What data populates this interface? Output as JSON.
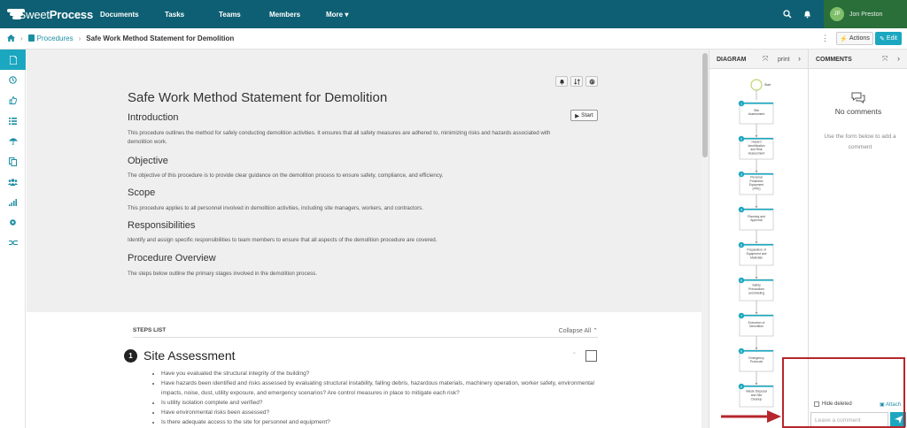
{
  "app": {
    "logo": {
      "sweet": "Sweet",
      "process": "Process"
    },
    "nav": [
      "Documents",
      "Tasks",
      "Teams",
      "Members",
      "More"
    ],
    "user": {
      "initials": "JP",
      "name": "Jon Preston"
    }
  },
  "breadcrumb": {
    "parent": "Procedures",
    "current": "Safe Work Method Statement for Demolition",
    "actions_label": "Actions",
    "edit_label": "Edit"
  },
  "document": {
    "title": "Safe Work Method Statement for Demolition",
    "start_label": "Start",
    "sections": [
      {
        "heading": "Introduction",
        "body": "This procedure outlines the method for safely conducting demolition activities. It ensures that all safety measures are adhered to, minimizing risks and hazards associated with demolition work."
      },
      {
        "heading": "Objective",
        "body": "The objective of this procedure is to provide clear guidance on the demolition process to ensure safety, compliance, and efficiency."
      },
      {
        "heading": "Scope",
        "body": "This procedure applies to all personnel involved in demolition activities, including site managers, workers, and contractors."
      },
      {
        "heading": "Responsibilities",
        "body": "Identify and assign specific responsibilities to team members to ensure that all aspects of the demolition procedure are covered."
      },
      {
        "heading": "Procedure Overview",
        "body": "The steps below outline the primary stages involved in the demolition process."
      }
    ]
  },
  "steps": {
    "label": "STEPS LIST",
    "collapse_label": "Collapse All",
    "step1": {
      "number": "1",
      "title": "Site Assessment",
      "items": [
        "Have you evaluated the structural integrity of the building?",
        "Have hazards been identified and risks assessed by evaluating structural instability, falling debris, hazardous materials, machinery operation, worker safety, environmental impacts, noise, dust, utility exposure, and emergency scenarios? Are control measures in place to mitigate each risk?",
        "Is utility isolation complete and verified?",
        "Have environmental risks been assessed?",
        "Is there adequate access to the site for personnel and equipment?"
      ]
    }
  },
  "diagram": {
    "title": "DIAGRAM",
    "print_label": "print",
    "start_label": "Start",
    "nodes": [
      {
        "n": "1",
        "label": "Site Assessment"
      },
      {
        "n": "2",
        "label": "Hazard Identification and Risk Assessment"
      },
      {
        "n": "3",
        "label": "Personal Protective Equipment (PPE)"
      },
      {
        "n": "4",
        "label": "Planning and Approval"
      },
      {
        "n": "5",
        "label": "Preparation of Equipment and Materials"
      },
      {
        "n": "6",
        "label": "Safety Precautions and Briefing"
      },
      {
        "n": "7",
        "label": "Execution of Demolition"
      },
      {
        "n": "8",
        "label": "Emergency Protocols"
      },
      {
        "n": "9",
        "label": "Waste Disposal and Site Cleanup"
      }
    ]
  },
  "comments": {
    "title": "COMMENTS",
    "empty_title": "No comments",
    "empty_hint": "Use the form below to add a comment",
    "hide_deleted": "Hide deleted",
    "attach": "Attach",
    "placeholder": "Leave a comment"
  }
}
